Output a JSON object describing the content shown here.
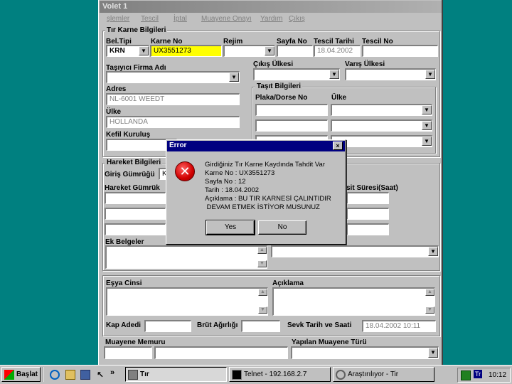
{
  "window": {
    "title": "Volet 1"
  },
  "menu": [
    "şlemler",
    "Tescil",
    "İptal",
    "Muayene Onayı",
    "Yardım",
    "Çıkış"
  ],
  "karne": {
    "group_title": "Tır Karne Bilgileri",
    "bel_tipi_label": "Bel.Tipi",
    "bel_tipi_value": "KRN",
    "karne_no_label": "Karne No",
    "karne_no_value": "UX3551273",
    "rejim_label": "Rejim",
    "sayfa_no_label": "Sayfa No",
    "tescil_tarihi_label": "Tescil Tarihi",
    "tescil_tarihi_value": "18.04.2002",
    "tescil_no_label": "Tescil No"
  },
  "firma": {
    "tasiyici_label": "Taşıyıcı Firma Adı",
    "adres_label": "Adres",
    "adres_value": "NL-6001 WEEDT",
    "ulke_label": "Ülke",
    "ulke_value": "HOLLANDA",
    "kefil_label": "Kefil Kuruluş"
  },
  "cikis_ulkesi_label": "Çıkış Ülkesi",
  "varis_ulkesi_label": "Varış Ülkesi",
  "tasit": {
    "group_title": "Taşıt Bilgileri",
    "plaka_label": "Plaka/Dorse No",
    "ulke_label": "Ülke"
  },
  "hareket": {
    "group_title": "Hareket Bilgileri",
    "giris_label": "Giriş Gümrüğü",
    "giris_value": "K",
    "gumruk_label": "Hareket Gümrük",
    "sure_label": "sit Süresi(Saat)"
  },
  "ek_belgeler_label": "Ek Belgeler",
  "esya_cinsi_label": "Eşya Cinsi",
  "aciklama_label": "Açıklama",
  "kap_adedi_label": "Kap Adedi",
  "brut_agirlik_label": "Brüt Ağırlığı",
  "sevk_label": "Sevk Tarih ve Saati",
  "sevk_value": "18.04.2002 10:11",
  "muayene_memuru_label": "Muayene Memuru",
  "muayene_turu_label": "Yapılan Muayene Türü",
  "dialog": {
    "title": "Error",
    "close": "×",
    "icon_glyph": "✕",
    "lines": [
      "Girdiğiniz Tır Karne Kaydında Tahdit Var",
      "Karne No : UX3551273",
      "Sayfa No : 12",
      "Tarih     : 18.04.2002",
      "Açıklama : BU TIR KARNESİ ÇALINTIDIR",
      " DEVAM ETMEK İSTİYOR MUSUNUZ"
    ],
    "yes_label": "Yes",
    "no_label": "No"
  },
  "taskbar": {
    "start_label": "Başlat",
    "arrows": "»",
    "tasks": [
      "Tır",
      "Telnet - 192.168.2.7",
      "Araştırılıyor - Tir"
    ],
    "tray_lang": "Tr",
    "clock": "10:12"
  },
  "colors": {
    "desktop": "#008080",
    "title_active": "#000080",
    "karne_field": "#ffff00"
  }
}
